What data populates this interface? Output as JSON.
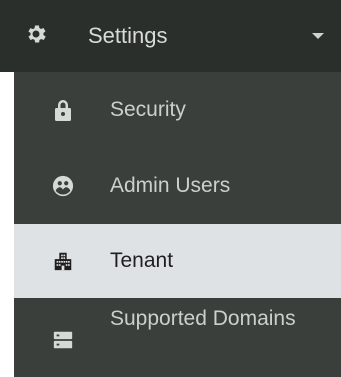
{
  "menu": {
    "header": {
      "label": "Settings",
      "icon": "gear-icon",
      "expand_icon": "chevron-down-icon"
    },
    "items": [
      {
        "label": "Security",
        "icon": "lock-icon",
        "active": false
      },
      {
        "label": "Admin Users",
        "icon": "admin-users-icon",
        "active": false
      },
      {
        "label": "Tenant",
        "icon": "building-icon",
        "active": true
      },
      {
        "label": "Supported Domains",
        "icon": "server-icon",
        "active": false
      }
    ]
  },
  "colors": {
    "header_bg": "#2b2f2c",
    "item_bg": "#3b3f3b",
    "active_bg": "#dfe2e5",
    "text_light": "#cbd0cb",
    "text_dark": "#1f1f1f"
  }
}
